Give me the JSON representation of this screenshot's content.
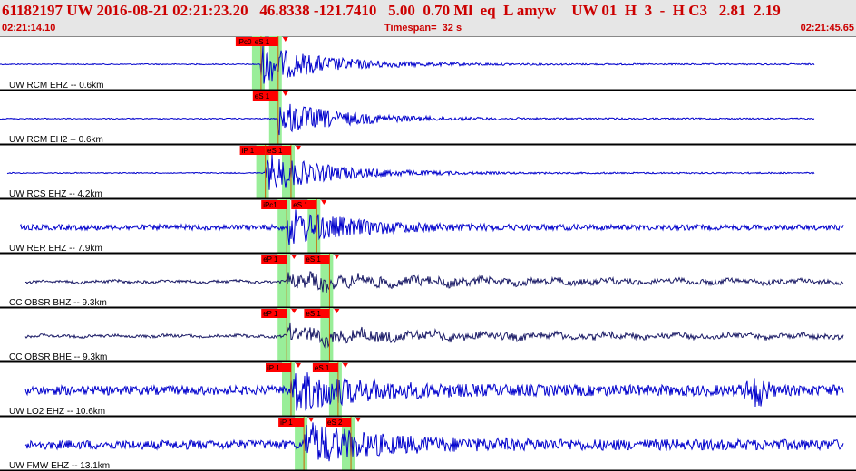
{
  "header": {
    "title": "61182197 UW 2016-08-21 02:21:23.20   46.8338 -121.7410   5.00  0.70 Ml  eq  L amyw    UW 01  H  3  -  H C3   2.81  2.19",
    "start_time": "02:21:14.10",
    "timespan": "Timespan=  32 s",
    "end_time": "02:21:45.65"
  },
  "colors": {
    "header_bg": "#e6e6e6",
    "header_text": "#cc0000",
    "blue_trace": "#0000cc",
    "navy_trace": "#1a1a66",
    "pick_window": "#99ee99",
    "pick_label_bg": "#ff0000",
    "divider": "#000000"
  },
  "traces": [
    {
      "label": "UW RCM EHZ -- 0.6km",
      "color": "blue",
      "picks": [
        {
          "label": "iPc0",
          "pos": 0.305
        },
        {
          "label": "eS 1",
          "pos": 0.325
        }
      ],
      "amp": 1.0
    },
    {
      "label": "UW RCM EH2 -- 0.6km",
      "color": "blue",
      "picks": [
        {
          "label": "eS 1",
          "pos": 0.325
        }
      ],
      "amp": 0.9
    },
    {
      "label": "UW RCS EHZ -- 4.2km",
      "color": "blue",
      "picks": [
        {
          "label": "iP 1",
          "pos": 0.31
        },
        {
          "label": "eS 1",
          "pos": 0.34
        }
      ],
      "amp": 1.0
    },
    {
      "label": "UW RER EHZ -- 7.9km",
      "color": "blue",
      "picks": [
        {
          "label": "iPc1",
          "pos": 0.335
        },
        {
          "label": "eS 1",
          "pos": 0.37
        }
      ],
      "amp": 0.9
    },
    {
      "label": "CC OBSR BHZ -- 9.3km",
      "color": "navy",
      "picks": [
        {
          "label": "eP 1",
          "pos": 0.335
        },
        {
          "label": "eS 1",
          "pos": 0.385
        }
      ],
      "amp": 0.8
    },
    {
      "label": "CC OBSR BHE -- 9.3km",
      "color": "navy",
      "picks": [
        {
          "label": "eP 1",
          "pos": 0.335
        },
        {
          "label": "eS 1",
          "pos": 0.385
        }
      ],
      "amp": 0.8
    },
    {
      "label": "UW LO2 EHZ -- 10.6km",
      "color": "blue",
      "picks": [
        {
          "label": "iP 1",
          "pos": 0.34
        },
        {
          "label": "eS 1",
          "pos": 0.395
        }
      ],
      "amp": 1.0
    },
    {
      "label": "UW FMW EHZ -- 13.1km",
      "color": "blue",
      "picks": [
        {
          "label": "iP 1",
          "pos": 0.355
        },
        {
          "label": "eS 2",
          "pos": 0.41
        }
      ],
      "amp": 1.0
    }
  ]
}
